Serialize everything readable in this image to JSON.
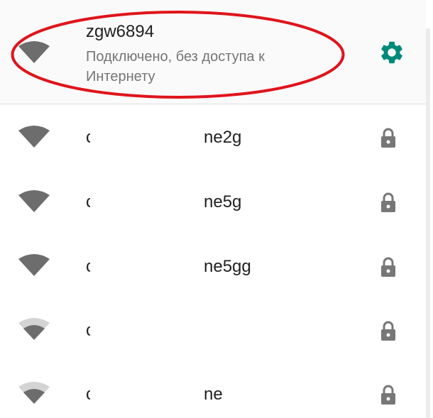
{
  "connected_network": {
    "ssid": "zgw6894",
    "status": "Подключено, без доступа к Интернету",
    "icon": "wifi-full-icon",
    "settings_icon": "gear-icon",
    "accent_color": "#00897b",
    "highlight_color": "#e0141b"
  },
  "networks": [
    {
      "ssid_prefix": "c",
      "ssid_suffix": "ne2g",
      "signal": "full",
      "secured": true
    },
    {
      "ssid_prefix": "c",
      "ssid_suffix": "ne5g",
      "signal": "full",
      "secured": true
    },
    {
      "ssid_prefix": "c",
      "ssid_suffix": "ne5gg",
      "signal": "full",
      "secured": true
    },
    {
      "ssid_prefix": "c",
      "ssid_suffix": "",
      "signal": "medium",
      "secured": true
    },
    {
      "ssid_prefix": "c",
      "ssid_suffix": "ne",
      "signal": "medium",
      "secured": true
    }
  ]
}
